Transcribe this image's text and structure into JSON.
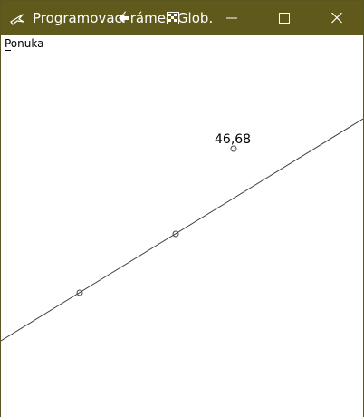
{
  "window": {
    "title": "Programovací rámec Glob…",
    "title_color": "#ffffff",
    "titlebar_color": "#5f5a1c",
    "app_icon": "bird-icon",
    "title_overlay_icons": [
      "left-arrow-icon",
      "checkered-icon"
    ],
    "buttons": {
      "minimize_icon": "minimize-icon",
      "maximize_icon": "maximize-icon",
      "close_icon": "close-icon"
    }
  },
  "menu": {
    "items": [
      {
        "label": "Ponuka",
        "mnemonic": "P"
      }
    ]
  },
  "canvas": {
    "background": "#ffffff",
    "line_color": "#404040",
    "label_value": "46,68"
  }
}
